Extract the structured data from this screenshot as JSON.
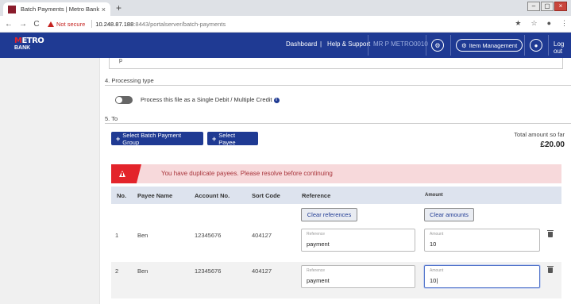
{
  "browser": {
    "tab_title": "Batch Payments | Metro Bank",
    "tab_close": "×",
    "new_tab": "+",
    "window_controls": [
      "–",
      "▢",
      "×"
    ],
    "nav": {
      "back": "←",
      "forward": "→",
      "reload": "C"
    },
    "security_label": "Not secure",
    "url_host": "10.248.87.188",
    "url_path": ":8443/portalserver/batch-payments"
  },
  "header": {
    "logo_top": "ETRO",
    "logo_bottom": "BANK",
    "nav_dashboard": "Dashboard",
    "nav_separator": "|",
    "nav_help": "Help & Support",
    "user_name": "MR P METRO0010",
    "item_management": "Item Management",
    "logout": "Log out"
  },
  "form": {
    "processing_section": "4. Processing type",
    "processing_toggle_label": "Process this file as a Single Debit / Multiple Credit",
    "to_section": "5. To",
    "select_group_button": "Select Batch Payment Group",
    "select_payee_button": "Select Payee",
    "total_label": "Total amount so far",
    "total_value": "£20.00"
  },
  "alert": {
    "message": "You have duplicate payees. Please resolve before continuing"
  },
  "table": {
    "headers": {
      "no": "No.",
      "payee_name": "Payee Name",
      "account_no": "Account No.",
      "sort_code": "Sort Code",
      "reference": "Reference",
      "amount": "Amount"
    },
    "clear_references": "Clear references",
    "clear_amounts": "Clear amounts",
    "field_label_reference": "Reference",
    "field_label_amount": "Amount",
    "rows": [
      {
        "no": "1",
        "payee_name": "Ben",
        "account_no": "12345676",
        "sort_code": "404127",
        "reference": "payment",
        "amount": "10"
      },
      {
        "no": "2",
        "payee_name": "Ben",
        "account_no": "12345676",
        "sort_code": "404127",
        "reference": "payment",
        "amount": "10|"
      }
    ]
  },
  "colors": {
    "brand_blue": "#1f3a93",
    "alert_red": "#e3242b",
    "alert_bg": "#f7d9db"
  }
}
